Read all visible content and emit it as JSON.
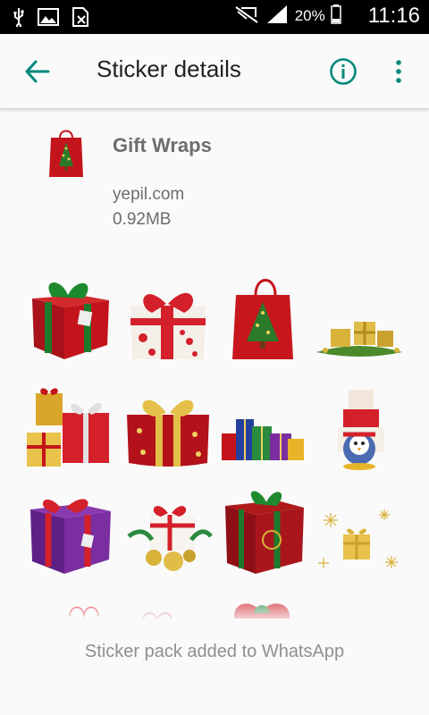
{
  "status_bar": {
    "battery_percent": "20%",
    "time": "11:16"
  },
  "app_bar": {
    "title": "Sticker details"
  },
  "pack": {
    "name": "Gift Wraps",
    "publisher": "yepil.com",
    "size": "0.92MB"
  },
  "footer": {
    "status_text": "Sticker pack added to WhatsApp"
  },
  "colors": {
    "accent": "#00897b",
    "gift_red": "#c4141b",
    "ribbon_green": "#1e7a2b",
    "gold": "#d9b23a"
  },
  "stickers": [
    "green-ribbon-red-gift-icon",
    "polka-dot-gift-icon",
    "christmas-tree-bag-icon",
    "gold-gifts-garland-icon",
    "gift-stack-icon",
    "gold-star-gift-icon",
    "colorful-gifts-icon",
    "penguin-gifts-icon",
    "purple-gift-icon",
    "ornaments-gift-icon",
    "holly-gift-icon",
    "sparkle-gold-gift-icon"
  ]
}
